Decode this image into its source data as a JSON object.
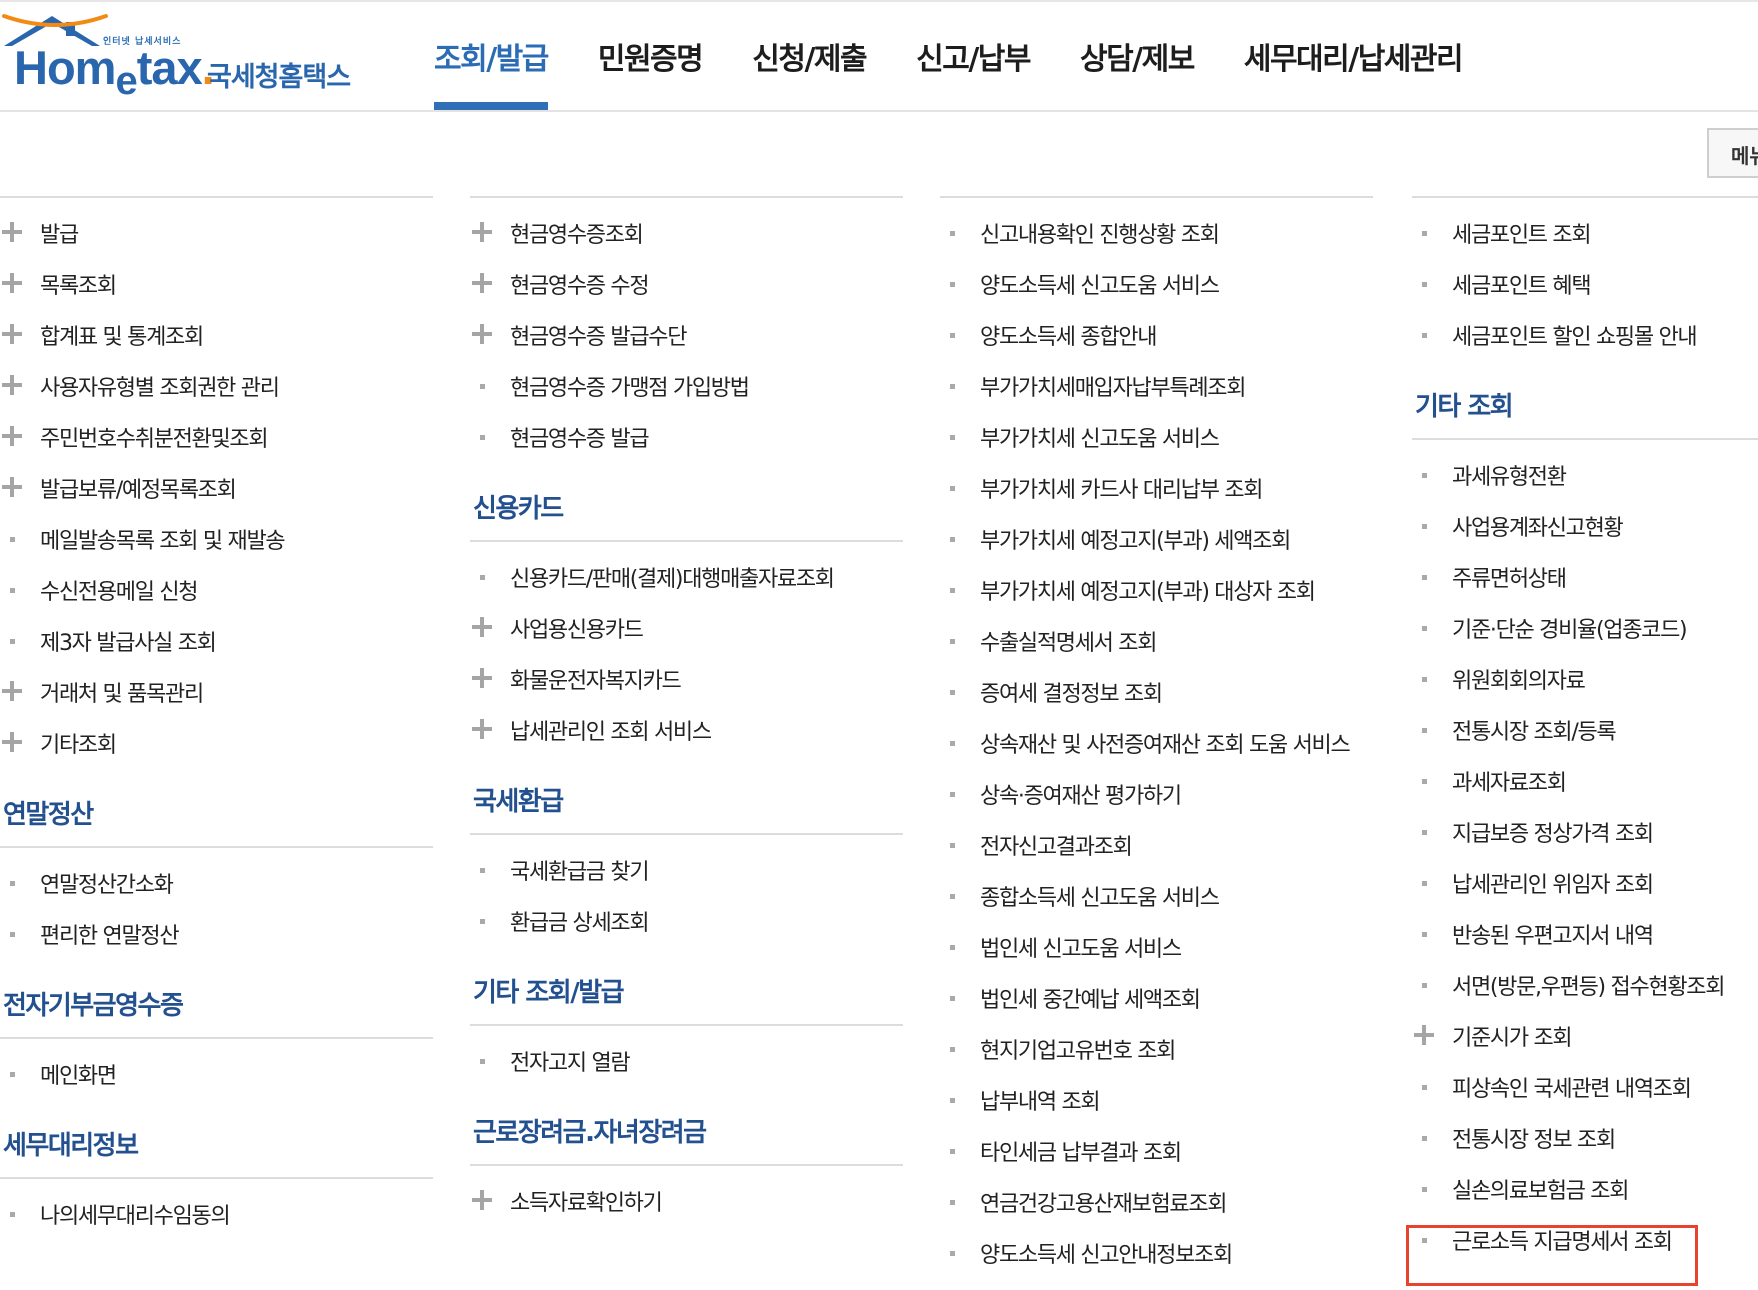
{
  "header": {
    "logo": {
      "tagline": "인터넷 납세서비스",
      "word_main": "Hom",
      "word_sub": "e",
      "word_end": "tax",
      "word_dot": ".",
      "korean": "국세청홈택스"
    },
    "nav": [
      {
        "label": "조회/발급",
        "active": true
      },
      {
        "label": "민원증명",
        "active": false
      },
      {
        "label": "신청/제출",
        "active": false
      },
      {
        "label": "신고/납부",
        "active": false
      },
      {
        "label": "상담/제보",
        "active": false
      },
      {
        "label": "세무대리/납세관리",
        "active": false
      }
    ],
    "menu_button": "메뉴"
  },
  "columns": {
    "col1": {
      "top_items": [
        {
          "label": "발급",
          "icon": "plus"
        },
        {
          "label": "목록조회",
          "icon": "plus"
        },
        {
          "label": "합계표 및 통계조회",
          "icon": "plus"
        },
        {
          "label": "사용자유형별 조회권한 관리",
          "icon": "plus"
        },
        {
          "label": "주민번호수취분전환및조회",
          "icon": "plus"
        },
        {
          "label": "발급보류/예정목록조회",
          "icon": "plus"
        },
        {
          "label": "메일발송목록 조회 및 재발송",
          "icon": "bullet"
        },
        {
          "label": "수신전용메일 신청",
          "icon": "bullet"
        },
        {
          "label": "제3자 발급사실 조회",
          "icon": "bullet"
        },
        {
          "label": "거래처 및 품목관리",
          "icon": "plus"
        },
        {
          "label": "기타조회",
          "icon": "plus"
        }
      ],
      "sections": [
        {
          "title": "연말정산",
          "items": [
            {
              "label": "연말정산간소화",
              "icon": "bullet"
            },
            {
              "label": "편리한 연말정산",
              "icon": "bullet"
            }
          ]
        },
        {
          "title": "전자기부금영수증",
          "items": [
            {
              "label": "메인화면",
              "icon": "bullet"
            }
          ]
        },
        {
          "title": "세무대리정보",
          "items": [
            {
              "label": "나의세무대리수임동의",
              "icon": "bullet"
            }
          ]
        }
      ]
    },
    "col2": {
      "top_items": [
        {
          "label": "현금영수증조회",
          "icon": "plus"
        },
        {
          "label": "현금영수증 수정",
          "icon": "plus"
        },
        {
          "label": "현금영수증 발급수단",
          "icon": "plus"
        },
        {
          "label": "현금영수증 가맹점 가입방법",
          "icon": "bullet"
        },
        {
          "label": "현금영수증 발급",
          "icon": "bullet"
        }
      ],
      "sections": [
        {
          "title": "신용카드",
          "items": [
            {
              "label": "신용카드/판매(결제)대행매출자료조회",
              "icon": "bullet"
            },
            {
              "label": "사업용신용카드",
              "icon": "plus"
            },
            {
              "label": "화물운전자복지카드",
              "icon": "plus"
            },
            {
              "label": "납세관리인 조회 서비스",
              "icon": "plus"
            }
          ]
        },
        {
          "title": "국세환급",
          "items": [
            {
              "label": "국세환급금 찾기",
              "icon": "bullet"
            },
            {
              "label": "환급금 상세조회",
              "icon": "bullet"
            }
          ]
        },
        {
          "title": "기타 조회/발급",
          "items": [
            {
              "label": "전자고지 열람",
              "icon": "bullet"
            }
          ]
        },
        {
          "title": "근로장려금.자녀장려금",
          "items": [
            {
              "label": "소득자료확인하기",
              "icon": "plus"
            }
          ]
        }
      ]
    },
    "col3": {
      "top_items": [
        {
          "label": "신고내용확인 진행상황 조회",
          "icon": "bullet"
        },
        {
          "label": "양도소득세 신고도움 서비스",
          "icon": "bullet"
        },
        {
          "label": "양도소득세 종합안내",
          "icon": "bullet"
        },
        {
          "label": "부가가치세매입자납부특례조회",
          "icon": "bullet"
        },
        {
          "label": "부가가치세 신고도움 서비스",
          "icon": "bullet"
        },
        {
          "label": "부가가치세 카드사 대리납부 조회",
          "icon": "bullet"
        },
        {
          "label": "부가가치세 예정고지(부과) 세액조회",
          "icon": "bullet"
        },
        {
          "label": "부가가치세 예정고지(부과) 대상자 조회",
          "icon": "bullet"
        },
        {
          "label": "수출실적명세서 조회",
          "icon": "bullet"
        },
        {
          "label": "증여세 결정정보 조회",
          "icon": "bullet"
        },
        {
          "label": "상속재산 및 사전증여재산 조회 도움 서비스",
          "icon": "bullet"
        },
        {
          "label": "상속·증여재산 평가하기",
          "icon": "bullet"
        },
        {
          "label": "전자신고결과조회",
          "icon": "bullet"
        },
        {
          "label": "종합소득세 신고도움 서비스",
          "icon": "bullet"
        },
        {
          "label": "법인세 신고도움 서비스",
          "icon": "bullet"
        },
        {
          "label": "법인세 중간예납 세액조회",
          "icon": "bullet"
        },
        {
          "label": "현지기업고유번호 조회",
          "icon": "bullet"
        },
        {
          "label": "납부내역 조회",
          "icon": "bullet"
        },
        {
          "label": "타인세금 납부결과 조회",
          "icon": "bullet"
        },
        {
          "label": "연금건강고용산재보험료조회",
          "icon": "bullet"
        },
        {
          "label": "양도소득세 신고안내정보조회",
          "icon": "bullet"
        }
      ],
      "sections": []
    },
    "col4": {
      "top_items": [
        {
          "label": "세금포인트 조회",
          "icon": "bullet"
        },
        {
          "label": "세금포인트 혜택",
          "icon": "bullet"
        },
        {
          "label": "세금포인트 할인 쇼핑몰 안내",
          "icon": "bullet"
        }
      ],
      "sections": [
        {
          "title": "기타 조회",
          "items": [
            {
              "label": "과세유형전환",
              "icon": "bullet"
            },
            {
              "label": "사업용계좌신고현황",
              "icon": "bullet"
            },
            {
              "label": "주류면허상태",
              "icon": "bullet"
            },
            {
              "label": "기준·단순 경비율(업종코드)",
              "icon": "bullet"
            },
            {
              "label": "위원회회의자료",
              "icon": "bullet"
            },
            {
              "label": "전통시장 조회/등록",
              "icon": "bullet"
            },
            {
              "label": "과세자료조회",
              "icon": "bullet"
            },
            {
              "label": "지급보증 정상가격 조회",
              "icon": "bullet"
            },
            {
              "label": "납세관리인 위임자 조회",
              "icon": "bullet"
            },
            {
              "label": "반송된 우편고지서 내역",
              "icon": "bullet"
            },
            {
              "label": "서면(방문,우편등) 접수현황조회",
              "icon": "bullet"
            },
            {
              "label": "기준시가 조회",
              "icon": "plus"
            },
            {
              "label": "피상속인 국세관련 내역조회",
              "icon": "bullet"
            },
            {
              "label": "전통시장 정보 조회",
              "icon": "bullet"
            },
            {
              "label": "실손의료보험금 조회",
              "icon": "bullet"
            },
            {
              "label": "근로소득 지급명세서 조회",
              "icon": "bullet",
              "highlighted": true
            }
          ]
        }
      ]
    }
  },
  "colors": {
    "brand_blue": "#2a66ad",
    "section_title": "#23508f",
    "active_nav": "#2b6cb5",
    "highlight_border": "#e8432f"
  }
}
